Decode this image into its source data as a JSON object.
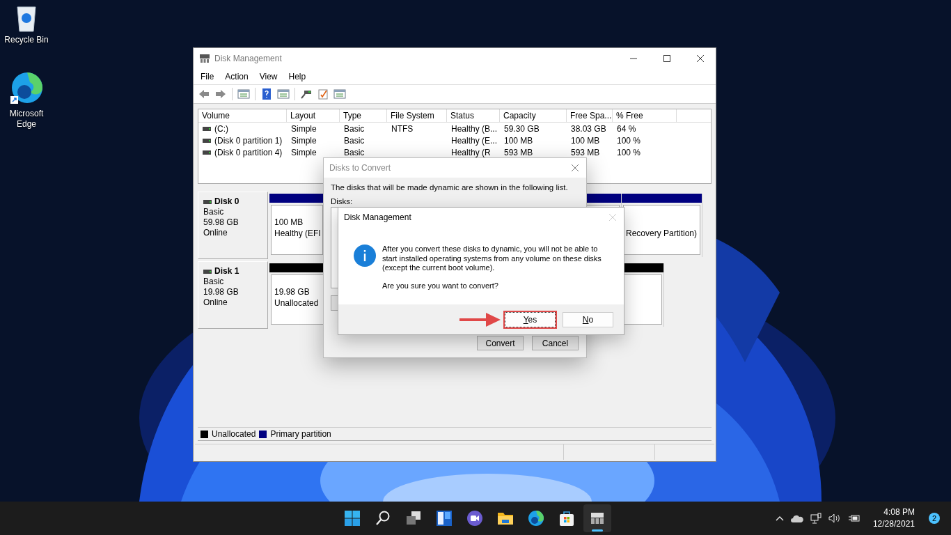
{
  "desktop_icons": [
    {
      "kind": "recycle-bin",
      "label": "Recycle Bin"
    },
    {
      "kind": "browser",
      "label": "Microsoft Edge"
    }
  ],
  "main_window": {
    "title": "Disk Management",
    "menu": [
      "File",
      "Action",
      "View",
      "Help"
    ],
    "volume_table": {
      "columns": [
        "Volume",
        "Layout",
        "Type",
        "File System",
        "Status",
        "Capacity",
        "Free Spa...",
        "% Free"
      ],
      "rows": [
        {
          "cells": [
            "(C:)",
            "Simple",
            "Basic",
            "NTFS",
            "Healthy (B...",
            "59.30 GB",
            "38.03 GB",
            "64 %"
          ]
        },
        {
          "cells": [
            "(Disk 0 partition 1)",
            "Simple",
            "Basic",
            "",
            "Healthy (E...",
            "100 MB",
            "100 MB",
            "100 %"
          ]
        },
        {
          "cells": [
            "(Disk 0 partition 4)",
            "Simple",
            "Basic",
            "",
            "Healthy (R",
            "593 MB",
            "593 MB",
            "100 %"
          ]
        }
      ]
    },
    "disks": [
      {
        "name": "Disk 0",
        "type": "Basic",
        "size": "59.98 GB",
        "status": "Online",
        "partitions": [
          {
            "color": "#000080",
            "lines": [
              "100 MB",
              "Healthy (EFI"
            ]
          },
          {
            "color": "#000080"
          },
          {
            "color": "#000080",
            "lines": [
              "Recovery Partition)"
            ]
          }
        ]
      },
      {
        "name": "Disk 1",
        "type": "Basic",
        "size": "19.98 GB",
        "status": "Online",
        "partitions": [
          {
            "color": "#000000",
            "lines": [
              "19.98 GB",
              "Unallocated"
            ]
          }
        ]
      }
    ],
    "legend": [
      {
        "label": "Unallocated",
        "color": "#000000"
      },
      {
        "label": "Primary partition",
        "color": "#000080"
      }
    ]
  },
  "convert_dialog": {
    "title": "Disks to Convert",
    "message": "The disks that will be made dynamic are shown in the following list.",
    "list_label": "Disks:",
    "buttons": [
      "Convert",
      "Cancel"
    ]
  },
  "confirm_dialog": {
    "title": "Disk Management",
    "message": "After you convert these disks to dynamic, you will not be able to start installed operating systems from any volume on these disks (except the current boot volume).",
    "question": "Are you sure you want to convert?",
    "buttons": [
      {
        "label": "Yes",
        "selected": true
      },
      {
        "label": "No",
        "selected": false
      }
    ]
  },
  "taskbar": {
    "apps": [
      {
        "kind": "start",
        "selected": false
      },
      {
        "kind": "search",
        "selected": false
      },
      {
        "kind": "task-view",
        "selected": false
      },
      {
        "kind": "widgets",
        "selected": false
      },
      {
        "kind": "chat",
        "selected": false
      },
      {
        "kind": "explorer",
        "selected": false
      },
      {
        "kind": "edge",
        "selected": false
      },
      {
        "kind": "store",
        "selected": false
      },
      {
        "kind": "disk-management",
        "selected": true
      }
    ],
    "time": "4:08 PM",
    "date": "12/28/2021",
    "notifications": "2"
  }
}
